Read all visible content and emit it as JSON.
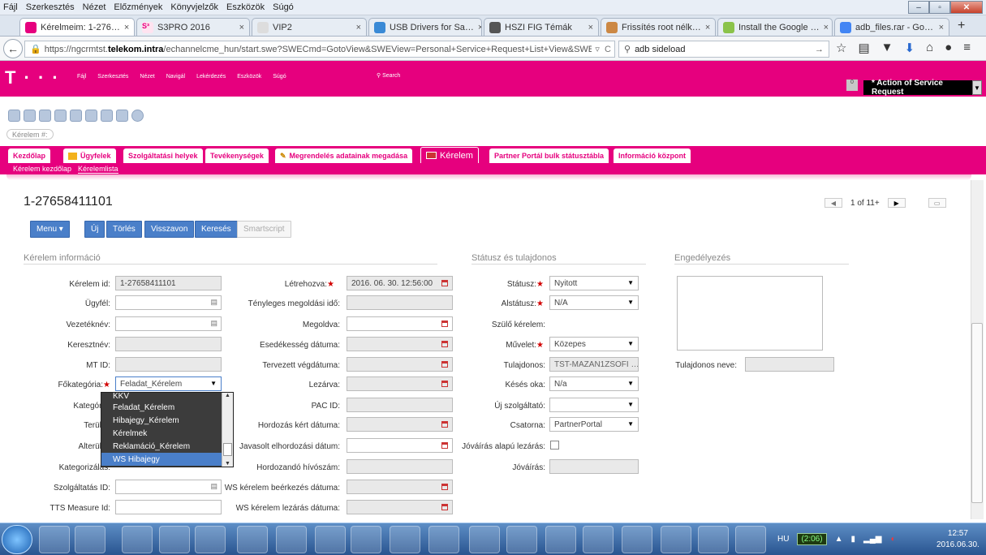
{
  "browser": {
    "menu": [
      "Fájl",
      "Szerkesztés",
      "Nézet",
      "Előzmények",
      "Könyvjelzők",
      "Eszközök",
      "Súgó"
    ],
    "tabs": [
      {
        "label": "Kérelmeim: 1-276…",
        "active": true
      },
      {
        "label": "S3PRO 2016"
      },
      {
        "label": "VIP2"
      },
      {
        "label": "USB Drivers for Sa…"
      },
      {
        "label": "HSZI FIG Témák"
      },
      {
        "label": "Frissítés root nélk…"
      },
      {
        "label": "Install the Google …"
      },
      {
        "label": "adb_files.rar - Go…"
      }
    ],
    "url_prefix": "https://ngcrmtst.",
    "url_host": "telekom.intra",
    "url_rest": "/echannelcme_hun/start.swe?SWECmd=GotoView&SWEView=Personal+Service+Request+List+View&SWER",
    "search_value": "adb sideload"
  },
  "app": {
    "logo": "T · · ·",
    "header_menu": [
      "Fájl",
      "Szerkesztés",
      "Nézet",
      "Navigál",
      "Lekérdezés",
      "Eszközök",
      "Súgó"
    ],
    "search_label": "Search",
    "header_box": "0",
    "action_select": "* Action of Service Request",
    "breadcrumb": "Kérelem #:",
    "screen_tabs": [
      "Kezdőlap",
      "Ügyfelek",
      "Szolgáltatási helyek",
      "Tevékenységek",
      "Megrendelés adatainak megadása",
      "Kérelem",
      "Partner Portál bulk státusztábla",
      "Információ központ"
    ],
    "sub_tabs": [
      "Kérelem kezdőlap",
      "Kérelemlista"
    ]
  },
  "record": {
    "id": "1-27658411101",
    "pager": "1 of 11+",
    "buttons": {
      "menu": "Menu ▾",
      "new": "Új",
      "delete": "Törlés",
      "undo": "Visszavon",
      "search": "Keresés",
      "smartscript": "Smartscript"
    }
  },
  "sections": {
    "info": "Kérelem információ",
    "status": "Státusz és tulajdonos",
    "approval": "Engedélyezés"
  },
  "col1": {
    "labels": [
      "Kérelem id:",
      "Ügyfél:",
      "Vezetéknév:",
      "Keresztnév:",
      "MT ID:",
      "Főkategória:",
      "Kategória:",
      "Terület:",
      "Alterület:",
      "Kategorizálás:",
      "Szolgáltatás ID:",
      "TTS Measure Id:"
    ],
    "request_id": "1-27658411101",
    "main_category": "Feladat_Kérelem"
  },
  "col2": {
    "labels": [
      "Létrehozva:",
      "Tényleges megoldási idő:",
      "Megoldva:",
      "Esedékesség dátuma:",
      "Tervezett végdátuma:",
      "Lezárva:",
      "PAC ID:",
      "Hordozás kért dátuma:",
      "Javasolt elhordozási dátum:",
      "Hordozandó hívószám:",
      "WS kérelem beérkezés dátuma:",
      "WS kérelem lezárás dátuma:"
    ],
    "created": "2016. 06. 30. 12:56:00"
  },
  "col3": {
    "labels": [
      "Státusz:",
      "Alstátusz:",
      "Szülő kérelem:",
      "Művelet:",
      "Tulajdonos:",
      "Késés oka:",
      "Új szolgáltató:",
      "Csatorna:",
      "Jóváírás alapú lezárás:",
      "Jóváírás:"
    ],
    "status": "Nyitott",
    "substatus": "N/A",
    "operation": "Közepes",
    "owner": "TST-MAZAN1ZSOFI …",
    "delay_reason": "N/a",
    "channel": "PartnerPortal"
  },
  "col4": {
    "owner_name_label": "Tulajdonos neve:"
  },
  "dropdown": {
    "items": [
      "KKV",
      "Feladat_Kérelem",
      "Hibajegy_Kérelem",
      "Kérelmek",
      "Reklamáció_Kérelem",
      "WS Hibajegy"
    ],
    "selected": "WS Hibajegy"
  },
  "taskbar": {
    "lang": "HU",
    "battery": "(2:06)",
    "time": "12:57",
    "date": "2016.06.30."
  }
}
